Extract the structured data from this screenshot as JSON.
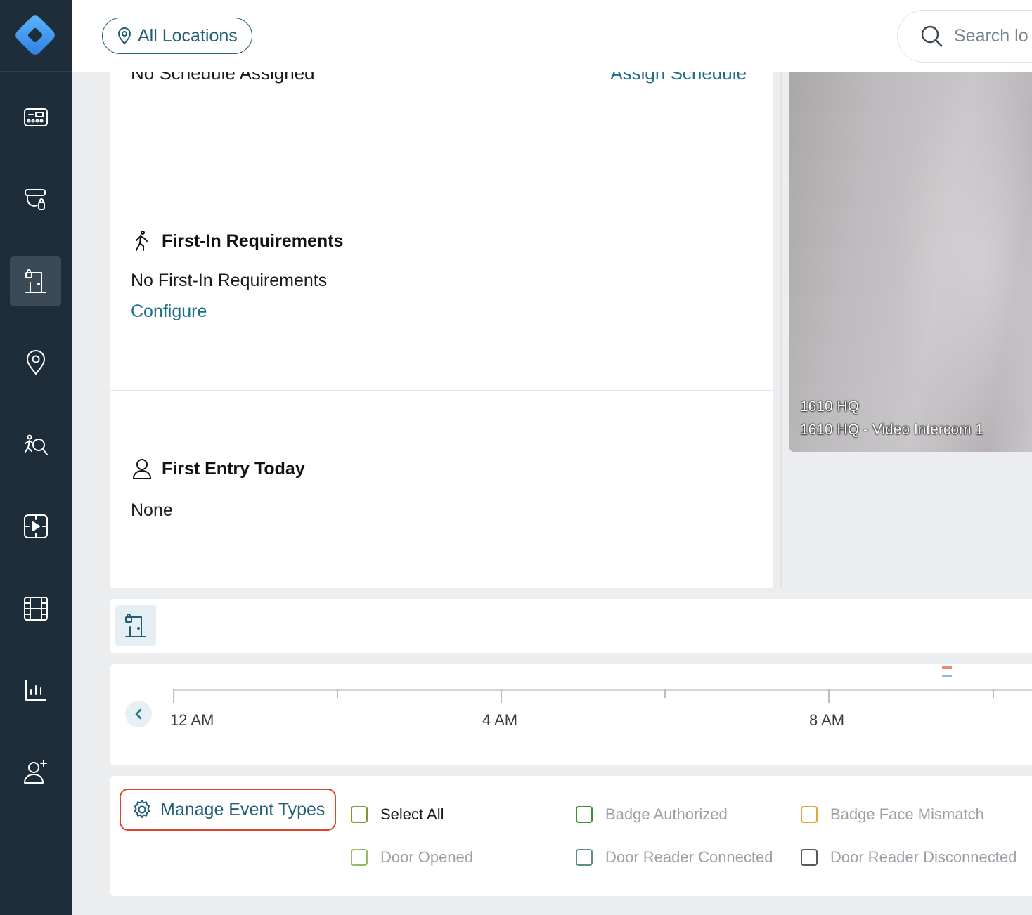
{
  "sidebar": {
    "items": [
      {
        "icon": "dashboard-panel-icon"
      },
      {
        "icon": "camera-lock-icon"
      },
      {
        "icon": "door-icon"
      },
      {
        "icon": "location-pin-icon"
      },
      {
        "icon": "person-search-icon"
      },
      {
        "icon": "video-player-icon"
      },
      {
        "icon": "film-icon"
      },
      {
        "icon": "bar-chart-icon"
      },
      {
        "icon": "add-user-icon"
      }
    ],
    "active_index": 2
  },
  "header": {
    "location_label": "All Locations",
    "search_placeholder": "Search lo"
  },
  "details": {
    "schedule_text": "No Schedule Assigned",
    "assign_schedule_link": "Assign Schedule",
    "first_in": {
      "title": "First-In Requirements",
      "value": "No First-In Requirements",
      "link": "Configure"
    },
    "first_entry": {
      "title": "First Entry Today",
      "value": "None"
    }
  },
  "video": {
    "site_name": "1610 HQ",
    "camera_name": "1610 HQ - Video Intercom 1"
  },
  "timeline": {
    "labels": [
      "12 AM",
      "4 AM",
      "8 AM"
    ],
    "marker_colors": [
      "#f08a6e",
      "#8fb4f0"
    ]
  },
  "events": {
    "manage_label": "Manage Event Types",
    "filters": [
      {
        "label": "Select All",
        "color": "#7a9a3a"
      },
      {
        "label": "Badge Authorized",
        "color": "#3f8f34"
      },
      {
        "label": "Badge Face Mismatch",
        "color": "#e8a23a"
      },
      {
        "label": "Door Opened",
        "color": "#9ab86a"
      },
      {
        "label": "Door Reader Connected",
        "color": "#5d8f8a"
      },
      {
        "label": "Door Reader Disconnected",
        "color": "#555a60"
      }
    ]
  }
}
